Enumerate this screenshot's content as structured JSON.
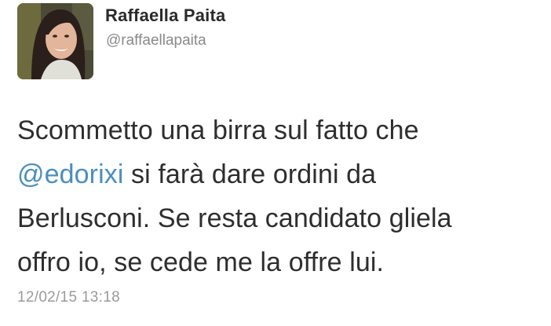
{
  "author": {
    "name": "Raffaella Paita",
    "handle": "@raffaellapaita"
  },
  "tweet": {
    "line1": "Scommetto una birra sul fatto che",
    "mention": "@edorixi",
    "line2_rest": " si farà dare ordini da",
    "line3": "Berlusconi. Se resta candidato gliela",
    "line4": "offro io, se cede me la offre lui."
  },
  "timestamp": "12/02/15 13:18",
  "colors": {
    "mention": "#4a8fc0",
    "name": "#2a2a2a",
    "muted": "#9a9a9a"
  },
  "icons": {
    "avatar": "profile-photo"
  }
}
